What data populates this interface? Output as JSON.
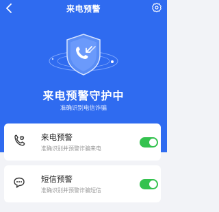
{
  "header": {
    "title": "来电预警",
    "back_icon": "back-chevron-icon",
    "settings_icon": "gear-icon"
  },
  "hero": {
    "title": "来电预警守护中",
    "subtitle": "准确识别电信诈骗",
    "illustration": "shield-incoming-call-icon",
    "background": "#2f6bf0"
  },
  "features": [
    {
      "icon": "phone-call-icon",
      "title": "来电预警",
      "description": "准确识别并预警诈骗来电",
      "enabled": true
    },
    {
      "icon": "sms-bubble-icon",
      "title": "短信预警",
      "description": "准确识别并预警诈骗短信",
      "enabled": true
    }
  ],
  "colors": {
    "accent": "#2f6bf0",
    "toggle_on": "#34c24f"
  }
}
